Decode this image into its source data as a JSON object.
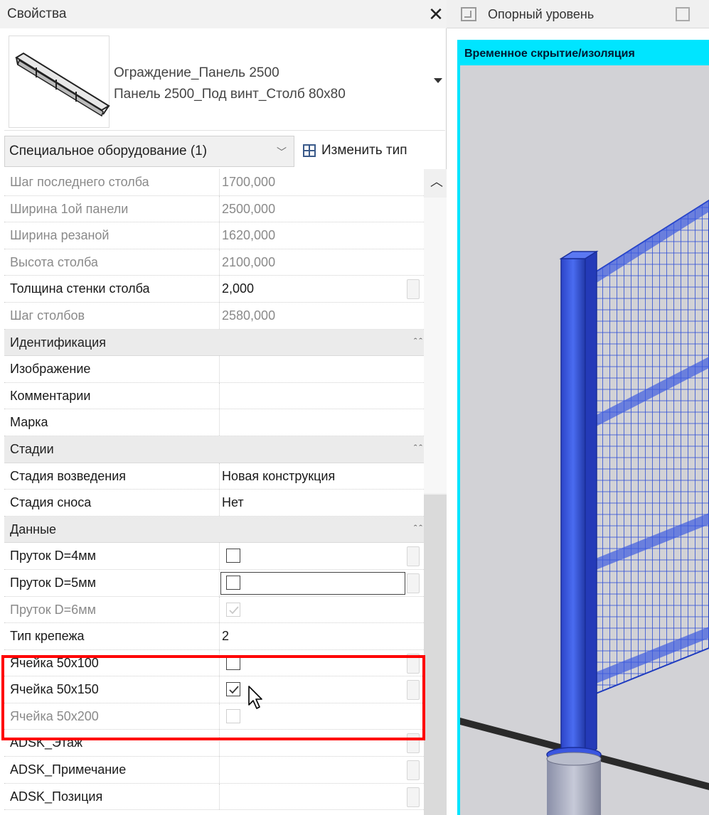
{
  "panel": {
    "title": "Свойства",
    "close_icon": "close-icon"
  },
  "type_selector": {
    "family": "Ограждение_Панель 2500",
    "type": "Панель 2500_Под винт_Столб 80x80"
  },
  "instance_filter": {
    "label": "Специальное оборудование (1)"
  },
  "edit_type": {
    "label": "Изменить тип"
  },
  "rows": [
    {
      "kind": "param",
      "name": "Шаг последнего столба",
      "value": "1700,000",
      "readonly": true
    },
    {
      "kind": "param",
      "name": "Ширина 1ой панели",
      "value": "2500,000",
      "readonly": true
    },
    {
      "kind": "param",
      "name": "Ширина резаной",
      "value": "1620,000",
      "readonly": true
    },
    {
      "kind": "param",
      "name": "Высота столба",
      "value": "2100,000",
      "readonly": true
    },
    {
      "kind": "param",
      "name": "Толщина стенки столба",
      "value": "2,000",
      "readonly": false
    },
    {
      "kind": "param",
      "name": "Шаг столбов",
      "value": "2580,000",
      "readonly": true
    },
    {
      "kind": "group",
      "name": "Идентификация"
    },
    {
      "kind": "param",
      "name": "Изображение",
      "value": "",
      "readonly": false
    },
    {
      "kind": "param",
      "name": "Комментарии",
      "value": "",
      "readonly": false
    },
    {
      "kind": "param",
      "name": "Марка",
      "value": "",
      "readonly": false
    },
    {
      "kind": "group",
      "name": "Стадии"
    },
    {
      "kind": "param",
      "name": "Стадия возведения",
      "value": "Новая конструкция",
      "readonly": false
    },
    {
      "kind": "param",
      "name": "Стадия сноса",
      "value": "Нет",
      "readonly": false
    },
    {
      "kind": "group",
      "name": "Данные"
    },
    {
      "kind": "check",
      "name": "Пруток D=4мм",
      "checked": false,
      "readonly": false
    },
    {
      "kind": "check",
      "name": "Пруток D=5мм",
      "checked": false,
      "readonly": false,
      "editing": true
    },
    {
      "kind": "check",
      "name": "Пруток D=6мм",
      "checked": true,
      "readonly": true
    },
    {
      "kind": "param",
      "name": "Тип крепежа",
      "value": "2",
      "readonly": false
    },
    {
      "kind": "check",
      "name": "Ячейка 50x100",
      "checked": false,
      "readonly": false
    },
    {
      "kind": "check",
      "name": "Ячейка 50x150",
      "checked": true,
      "readonly": false
    },
    {
      "kind": "check",
      "name": "Ячейка 50x200",
      "checked": false,
      "readonly": true
    },
    {
      "kind": "param",
      "name": "ADSK_Этаж",
      "value": "",
      "readonly": false
    },
    {
      "kind": "param",
      "name": "ADSK_Примечание",
      "value": "",
      "readonly": false
    },
    {
      "kind": "param",
      "name": "ADSK_Позиция",
      "value": "",
      "readonly": false
    }
  ],
  "view": {
    "tab_label": "Опорный уровень",
    "banner": "Временное скрытие/изоляция"
  },
  "colors": {
    "highlight": "#ff0000",
    "viewport_border": "#00e5ff",
    "fence_blue": "#3355dd"
  }
}
